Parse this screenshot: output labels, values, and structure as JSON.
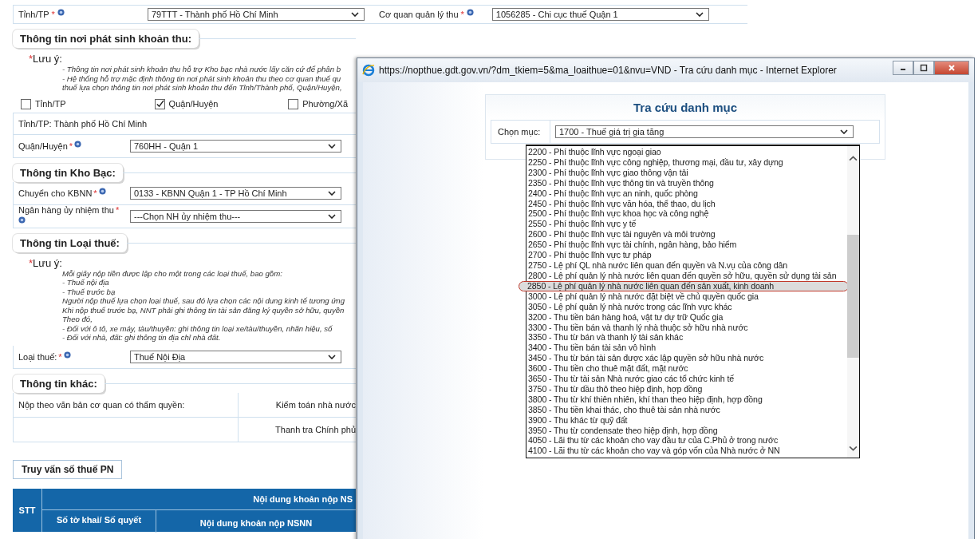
{
  "top_fields": [
    {
      "label": "Tỉnh/TP",
      "mark": "*",
      "value": "79TTT - Thành phố Hồ Chí Minh"
    },
    {
      "label": "Cơ quan quản lý thu",
      "mark": "*",
      "value": "1056285 - Chi cục thuế Quận 1"
    }
  ],
  "origin_section": {
    "title": "Thông tin nơi phát sinh khoản thu:",
    "note_mark": "*",
    "note_label": "Lưu ý:",
    "notes": [
      "- Thông tin nơi phát sinh khoản thu hỗ trợ Kho bạc nhà nước lấy căn cứ để phân b",
      "- Hệ thống hỗ trợ mặc định thông tin nơi phát sinh khoản thu theo cơ quan thuế qu",
      "thuế lựa chọn thông tin nơi phát sinh khoản thu đến Tỉnh/Thành phố, Quận/Huyện,"
    ],
    "checkboxes": [
      {
        "label": "Tỉnh/TP",
        "checked": false
      },
      {
        "label": "Quận/Huyện",
        "checked": true
      },
      {
        "label": "Phường/Xã",
        "checked": false
      }
    ],
    "province_text": "Tỉnh/TP: Thành phố Hồ Chí Minh",
    "district": {
      "label": "Quận/Huyện",
      "mark": "*",
      "value": "760HH - Quận 1"
    }
  },
  "treasury_section": {
    "title": "Thông tin Kho Bạc:",
    "fields": [
      {
        "label": "Chuyển cho KBNN",
        "mark": "*",
        "value": "0133 - KBNN Quận 1 - TP Hồ Chí Minh"
      },
      {
        "label": "Ngân hàng ủy nhiệm thu",
        "mark": "*",
        "value": "---Chọn NH ủy nhiệm thu---"
      }
    ]
  },
  "tax_type_section": {
    "title": "Thông tin Loại thuế:",
    "note_mark": "*",
    "note_label": "Lưu ý:",
    "notes": [
      "Mỗi giấy nộp tiền được lập cho một trong các loại thuế, bao gồm:",
      "- Thuế nội địa",
      "- Thuế trước bạ",
      "Người nộp thuế lựa chọn loại thuế, sau đó lựa chọn các nội dung kinh tế tương ứng",
      "Khi nộp thuế trước bạ, NNT phải ghi thông tin tài sản đăng ký quyền sở hữu, quyền",
      "Theo đó,",
      "- Đối với ô tô, xe máy, tàu/thuyền: ghi thông tin loại xe/tàu/thuyền, nhãn hiệu, số",
      "- Đối với nhà, đất: ghi thông tin địa chỉ nhà đất."
    ],
    "field": {
      "label": "Loại thuế:",
      "mark": "*",
      "value": "Thuế Nội Địa"
    }
  },
  "other_section": {
    "title": "Thông tin khác:",
    "rows": [
      {
        "label": "Nộp theo văn bản cơ quan có thẩm quyền:",
        "option": "Kiểm toán nhà nước"
      },
      {
        "option": "Thanh tra Chính phủ"
      }
    ]
  },
  "query_button": "Truy vấn số thuế PN",
  "table": {
    "columns": [
      "STT",
      "Nội dung khoản nộp NS",
      "Số tờ khai/ Số quyết",
      "Nội dung khoản nộp NSNN"
    ]
  },
  "popup": {
    "title": "https://nopthue.gdt.gov.vn/?dm_tkiem=5&ma_loaithue=01&nvu=VND - Tra cứu danh mục - Internet Explorer",
    "heading": "Tra cứu danh mục",
    "select_label": "Chọn mục:",
    "select_value": "1700 - Thuế giá trị gia tăng",
    "options": [
      {
        "label": "2200 - Phí thuộc lĩnh vực ngoại giao",
        "selected": false,
        "circled": false
      },
      {
        "label": "2250 - Phí thuộc lĩnh vực công nghiệp, thương mại, đầu tư, xây dựng",
        "selected": false,
        "circled": false
      },
      {
        "label": "2300 - Phí thuộc lĩnh vực giao thông vận tải",
        "selected": false,
        "circled": false
      },
      {
        "label": "2350 - Phí thuộc lĩnh vực thông tin và truyền thông",
        "selected": false,
        "circled": false
      },
      {
        "label": "2400 - Phí thuộc lĩnh vực an ninh, quốc phòng",
        "selected": false,
        "circled": false
      },
      {
        "label": "2450 - Phí thuộc lĩnh vực văn hóa, thể thao, du lịch",
        "selected": false,
        "circled": false
      },
      {
        "label": "2500 - Phí thuộc lĩnh vực khoa học và công nghệ",
        "selected": false,
        "circled": false
      },
      {
        "label": "2550 - Phí thuộc lĩnh vực y tế",
        "selected": false,
        "circled": false
      },
      {
        "label": "2600 - Phí thuộc lĩnh vực tài nguyên và môi trường",
        "selected": false,
        "circled": false
      },
      {
        "label": "2650 - Phí thuộc lĩnh vực tài chính, ngân hàng, bảo hiểm",
        "selected": false,
        "circled": false
      },
      {
        "label": "2700 - Phí thuộc lĩnh vực tư pháp",
        "selected": false,
        "circled": false
      },
      {
        "label": "2750 - Lệ phí QL nhà nước liên quan đến quyền và N.vụ của công dân",
        "selected": false,
        "circled": false
      },
      {
        "label": "2800 - Lệ phí quản lý nhà nước liên quan đến quyền sở hữu, quyền sử dụng tài sản",
        "selected": false,
        "circled": false
      },
      {
        "label": "2850 - Lệ phí quản lý nhà nước liên quan đến sản xuất, kinh doanh",
        "selected": true,
        "circled": true
      },
      {
        "label": "3000 - Lệ phí quản lý nhà nước đặt biệt về chủ quyền quốc gia",
        "selected": false,
        "circled": false
      },
      {
        "label": "3050 - Lệ phí quản lý nhà nước trong các lĩnh vực khác",
        "selected": false,
        "circled": false
      },
      {
        "label": "3200 - Thu tiền bán hàng hoá, vật tư dự trữ Quốc gia",
        "selected": false,
        "circled": false
      },
      {
        "label": "3300 - Thu tiền bán và thanh lý nhà thuộc sở hữu nhà nước",
        "selected": false,
        "circled": false
      },
      {
        "label": "3350 - Thu từ bán và thanh lý tài sản khác",
        "selected": false,
        "circled": false
      },
      {
        "label": "3400 - Thu tiền bán tài sản vô hình",
        "selected": false,
        "circled": false
      },
      {
        "label": "3450 - Thu từ bán tài sản được xác lập quyền sở hữu nhà nước",
        "selected": false,
        "circled": false
      },
      {
        "label": "3600 - Thu tiền cho thuê mặt đất, mặt nước",
        "selected": false,
        "circled": false
      },
      {
        "label": "3650 - Thu từ tài sản Nhà nước giao các tổ chức kinh tế",
        "selected": false,
        "circled": false
      },
      {
        "label": "3750 - Thu từ dầu thô theo hiệp định, hợp đồng",
        "selected": false,
        "circled": false
      },
      {
        "label": "3800 - Thu từ khí thiên nhiên, khí than theo hiệp định, hợp đồng",
        "selected": false,
        "circled": false
      },
      {
        "label": "3850 - Thu tiền khai thác, cho thuê tài sản nhà nước",
        "selected": false,
        "circled": false
      },
      {
        "label": "3900 - Thu khác từ quỹ đất",
        "selected": false,
        "circled": false
      },
      {
        "label": "3950 - Thu từ condensate theo hiệp định, hợp đồng",
        "selected": false,
        "circled": false
      },
      {
        "label": "4050 - Lãi thu từ các khoản cho vay đầu tư của C.Phủ ở trong nước",
        "selected": false,
        "circled": false
      },
      {
        "label": "4100 - Lãi thu từ các khoản cho vay và góp vốn của Nhà nước ở NN",
        "selected": false,
        "circled": false
      }
    ]
  }
}
